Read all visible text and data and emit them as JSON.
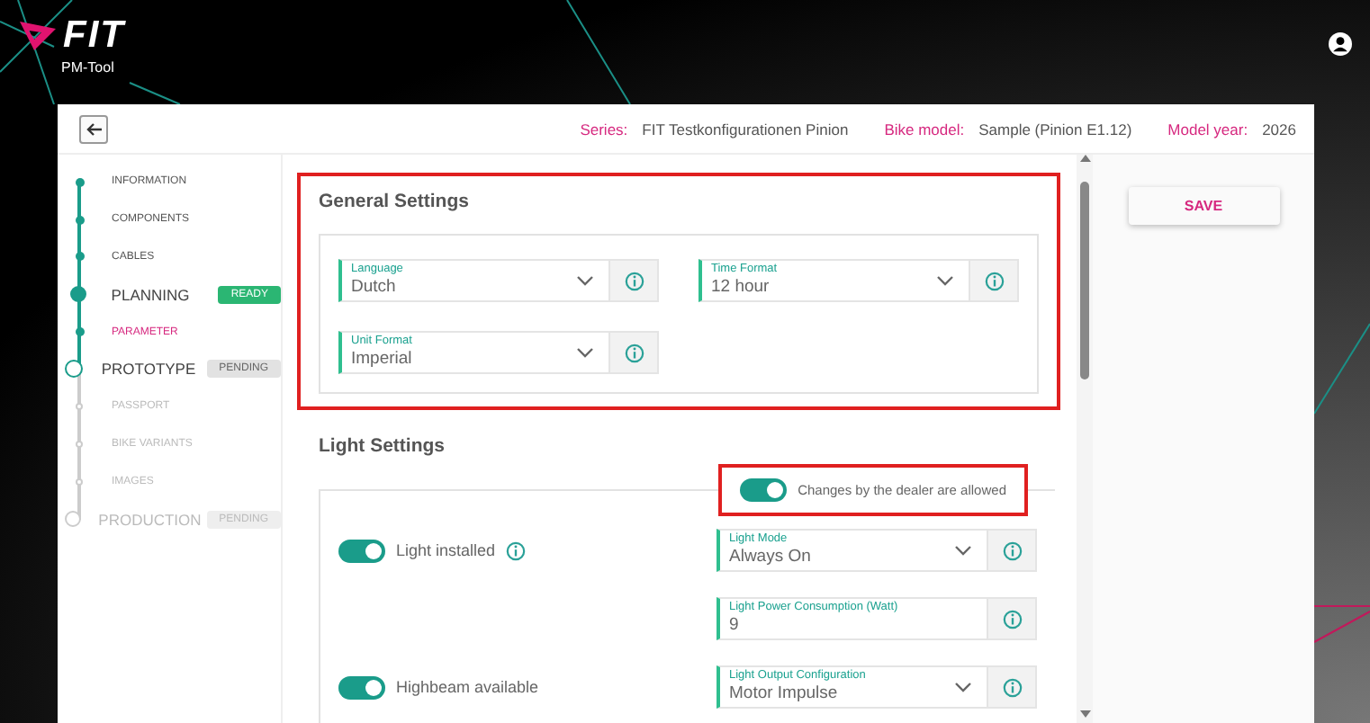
{
  "header": {
    "brand": "FIT",
    "subtitle": "PM-Tool"
  },
  "topbar": {
    "meta": [
      {
        "label": "Series:",
        "value": "FIT Testkonfigurationen Pinion"
      },
      {
        "label": "Bike model:",
        "value": "Sample (Pinion E1.12)"
      },
      {
        "label": "Model year:",
        "value": "2026"
      }
    ]
  },
  "steps": [
    {
      "kind": "sub",
      "label": "INFORMATION",
      "completed": true,
      "current": false,
      "selected": false
    },
    {
      "kind": "sub",
      "label": "COMPONENTS",
      "completed": true,
      "current": false,
      "selected": false
    },
    {
      "kind": "sub",
      "label": "CABLES",
      "completed": true,
      "current": false,
      "selected": false
    },
    {
      "kind": "main",
      "label": "PLANNING",
      "completed": true,
      "current": false,
      "selected": false,
      "badge": {
        "text": "READY",
        "kind": "ready"
      }
    },
    {
      "kind": "sub",
      "label": "PARAMETER",
      "completed": true,
      "current": false,
      "selected": true
    },
    {
      "kind": "main",
      "label": "PROTOTYPE",
      "completed": false,
      "current": true,
      "selected": false,
      "badge": {
        "text": "PENDING",
        "kind": "pending"
      }
    },
    {
      "kind": "sub",
      "label": "PASSPORT",
      "completed": false,
      "current": false,
      "selected": false
    },
    {
      "kind": "sub",
      "label": "BIKE VARIANTS",
      "completed": false,
      "current": false,
      "selected": false
    },
    {
      "kind": "sub",
      "label": "IMAGES",
      "completed": false,
      "current": false,
      "selected": false
    },
    {
      "kind": "main",
      "label": "PRODUCTION",
      "completed": false,
      "current": false,
      "selected": false,
      "badge": {
        "text": "PENDING",
        "kind": "muted"
      }
    }
  ],
  "general_settings": {
    "title": "General Settings",
    "highlighted": true,
    "fields": [
      {
        "kind": "select",
        "label": "Language",
        "value": "Dutch"
      },
      {
        "kind": "select",
        "label": "Time Format",
        "value": "12 hour"
      },
      {
        "kind": "select",
        "label": "Unit Format",
        "value": "Imperial"
      }
    ]
  },
  "light_settings": {
    "title": "Light Settings",
    "dealer_toggle": {
      "label": "Changes by the dealer are allowed",
      "on": true,
      "highlighted": true
    },
    "rows": [
      {
        "toggle": {
          "label": "Light installed",
          "on": true,
          "info": true
        },
        "field": {
          "kind": "select",
          "label": "Light Mode",
          "value": "Always On"
        }
      },
      {
        "field": {
          "kind": "input",
          "label": "Light Power Consumption (Watt)",
          "value": "9"
        }
      },
      {
        "toggle": {
          "label": "Highbeam available",
          "on": true,
          "info": false
        },
        "field": {
          "kind": "select",
          "label": "Light Output Configuration",
          "value": "Motor Impulse"
        }
      }
    ]
  },
  "save_button": "SAVE"
}
